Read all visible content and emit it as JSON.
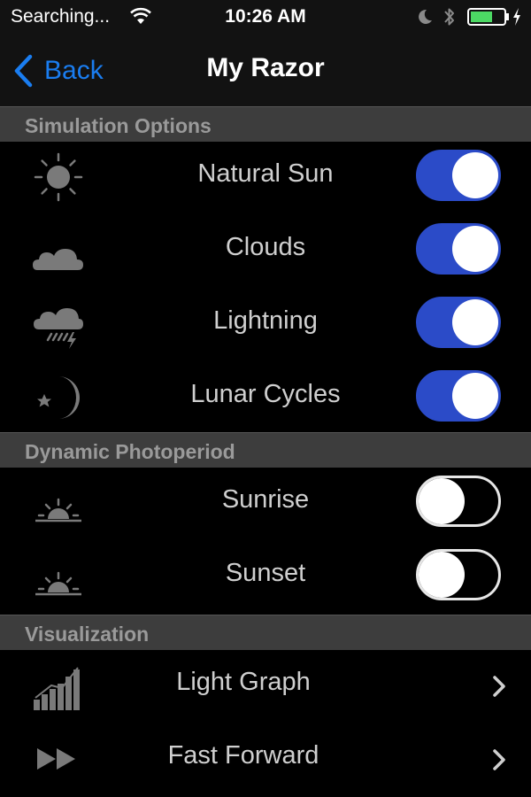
{
  "status": {
    "carrier": "Searching...",
    "time": "10:26 AM"
  },
  "nav": {
    "back_label": "Back",
    "title": "My Razor"
  },
  "sections": {
    "simulation": {
      "title": "Simulation Options",
      "items": [
        {
          "label": "Natural Sun",
          "icon": "sun-icon",
          "enabled": true
        },
        {
          "label": "Clouds",
          "icon": "cloud-icon",
          "enabled": true
        },
        {
          "label": "Lightning",
          "icon": "lightning-cloud-icon",
          "enabled": true
        },
        {
          "label": "Lunar Cycles",
          "icon": "moon-star-icon",
          "enabled": true
        }
      ]
    },
    "photoperiod": {
      "title": "Dynamic Photoperiod",
      "items": [
        {
          "label": "Sunrise",
          "icon": "sunrise-icon",
          "enabled": false
        },
        {
          "label": "Sunset",
          "icon": "sunset-icon",
          "enabled": false
        }
      ]
    },
    "visualization": {
      "title": "Visualization",
      "items": [
        {
          "label": "Light Graph",
          "icon": "bar-graph-icon"
        },
        {
          "label": "Fast Forward",
          "icon": "fast-forward-icon"
        }
      ]
    }
  },
  "colors": {
    "accent": "#1a7df0",
    "toggle_on": "#2b4bc8",
    "section_header_bg": "#3d3d3d",
    "battery_green": "#4cd964"
  }
}
